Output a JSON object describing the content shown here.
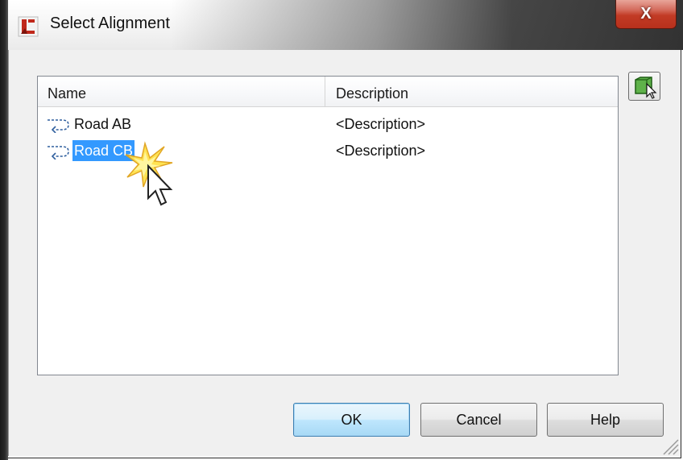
{
  "window": {
    "title": "Select Alignment",
    "close_label": "X"
  },
  "list": {
    "columns": [
      "Name",
      "Description"
    ],
    "rows": [
      {
        "name": "Road AB",
        "description": "<Description>",
        "icon": "alignment-icon",
        "selected": false
      },
      {
        "name": "Road CB",
        "description": "<Description>",
        "icon": "alignment-icon",
        "selected": true
      }
    ]
  },
  "buttons": {
    "ok": "OK",
    "cancel": "Cancel",
    "help": "Help",
    "pick_from_drawing": "pick-from-drawing-icon"
  },
  "colors": {
    "selection": "#3399ff",
    "close": "#c23b25",
    "default_button": "#bee6fd"
  }
}
